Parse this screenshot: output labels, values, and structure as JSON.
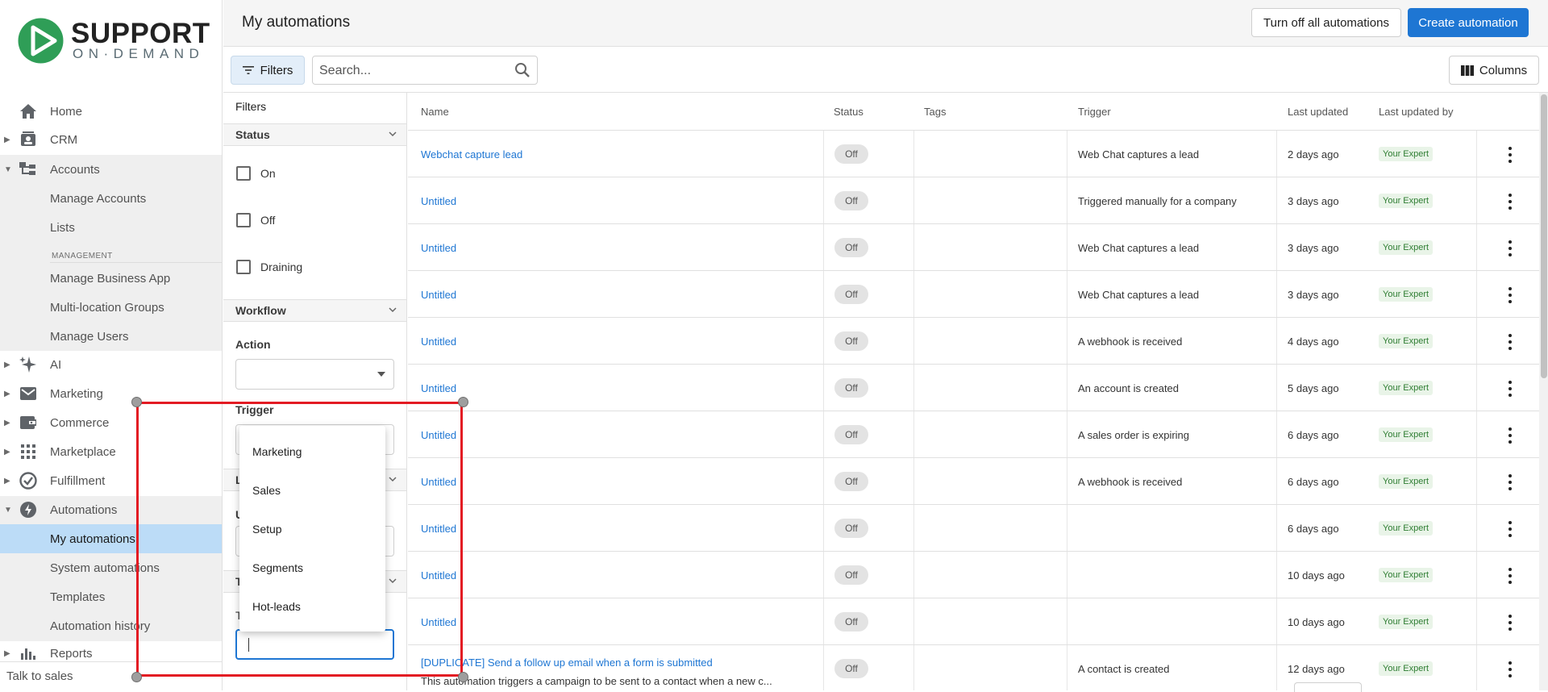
{
  "brand": {
    "line1": "SUPPORT",
    "line2": "ON·DEMAND",
    "colors": {
      "green": "#2f9e57",
      "accent": "#1e76d3"
    }
  },
  "sidebar": {
    "items": [
      {
        "label": "Home",
        "icon": "home-icon"
      },
      {
        "label": "CRM",
        "icon": "contacts-icon"
      },
      {
        "label": "Accounts",
        "icon": "accounts-tree-icon"
      },
      {
        "label": "Manage Accounts"
      },
      {
        "label": "Lists"
      },
      {
        "label": "Manage Business App"
      },
      {
        "label": "Multi-location Groups"
      },
      {
        "label": "Manage Users"
      },
      {
        "label": "AI",
        "icon": "sparkle-icon"
      },
      {
        "label": "Marketing",
        "icon": "mail-icon"
      },
      {
        "label": "Commerce",
        "icon": "wallet-icon"
      },
      {
        "label": "Marketplace",
        "icon": "grid-icon"
      },
      {
        "label": "Fulfillment",
        "icon": "check-circle-icon"
      },
      {
        "label": "Automations",
        "icon": "bolt-icon"
      },
      {
        "label": "My automations"
      },
      {
        "label": "System automations"
      },
      {
        "label": "Templates"
      },
      {
        "label": "Automation history"
      },
      {
        "label": "Reports",
        "icon": "bar-chart-icon"
      }
    ],
    "section_management": "MANAGEMENT",
    "talk_to_sales": "Talk to sales"
  },
  "header": {
    "title": "My automations",
    "turn_off_all": "Turn off all automations",
    "create": "Create automation"
  },
  "toolbar": {
    "filters": "Filters",
    "search_placeholder": "Search...",
    "columns": "Columns"
  },
  "filters": {
    "heading": "Filters",
    "status_title": "Status",
    "status_options": [
      "On",
      "Off",
      "Draining"
    ],
    "workflow_title": "Workflow",
    "action_label": "Action",
    "trigger_label": "Trigger",
    "partial_l": "L",
    "partial_u": "U",
    "partial_t1": "T",
    "partial_t2": "T"
  },
  "dropdown": {
    "options": [
      "Marketing",
      "Sales",
      "Setup",
      "Segments",
      "Hot-leads"
    ]
  },
  "table": {
    "headers": {
      "name": "Name",
      "status": "Status",
      "tags": "Tags",
      "trigger": "Trigger",
      "last_updated": "Last updated",
      "last_updated_by": "Last updated by"
    },
    "rows": [
      {
        "name": "Webchat capture lead",
        "status": "Off",
        "trigger": "Web Chat captures a lead",
        "updated": "2 days ago",
        "by": "Your Expert"
      },
      {
        "name": "Untitled",
        "status": "Off",
        "trigger": "Triggered manually for a company",
        "updated": "3 days ago",
        "by": "Your Expert"
      },
      {
        "name": "Untitled",
        "status": "Off",
        "trigger": "Web Chat captures a lead",
        "updated": "3 days ago",
        "by": "Your Expert"
      },
      {
        "name": "Untitled",
        "status": "Off",
        "trigger": "Web Chat captures a lead",
        "updated": "3 days ago",
        "by": "Your Expert"
      },
      {
        "name": "Untitled",
        "status": "Off",
        "trigger": "A webhook is received",
        "updated": "4 days ago",
        "by": "Your Expert"
      },
      {
        "name": "Untitled",
        "status": "Off",
        "trigger": "An account is created",
        "updated": "5 days ago",
        "by": "Your Expert"
      },
      {
        "name": "Untitled",
        "status": "Off",
        "trigger": "A sales order is expiring",
        "updated": "6 days ago",
        "by": "Your Expert"
      },
      {
        "name": "Untitled",
        "status": "Off",
        "trigger": "A webhook is received",
        "updated": "6 days ago",
        "by": "Your Expert"
      },
      {
        "name": "Untitled",
        "status": "Off",
        "trigger": "",
        "updated": "6 days ago",
        "by": "Your Expert"
      },
      {
        "name": "Untitled",
        "status": "Off",
        "trigger": "",
        "updated": "10 days ago",
        "by": "Your Expert"
      },
      {
        "name": "Untitled",
        "status": "Off",
        "trigger": "",
        "updated": "10 days ago",
        "by": "Your Expert"
      },
      {
        "name": "[DUPLICATE] Send a follow up email when a form is submitted",
        "desc": "This automation triggers a campaign to be sent to a contact when a new c...",
        "status": "Off",
        "trigger": "A contact is created",
        "updated": "12 days ago",
        "by": "Your Expert"
      }
    ]
  }
}
